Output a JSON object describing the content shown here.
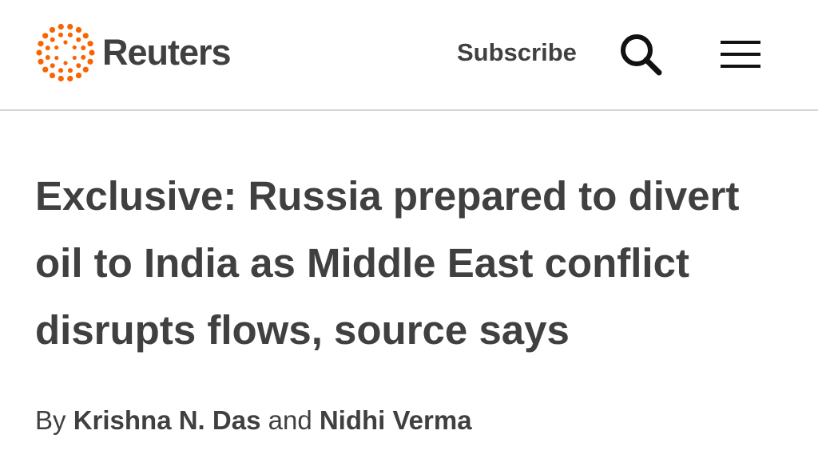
{
  "brand": {
    "name": "Reuters",
    "accent_color": "#fa6400",
    "text_color": "#404040"
  },
  "header": {
    "subscribe_label": "Subscribe",
    "search_icon": "search-icon",
    "menu_icon": "hamburger-menu-icon"
  },
  "article": {
    "headline": "Exclusive: Russia prepared to divert oil to India as Middle East conflict disrupts flows, source says",
    "byline": {
      "prefix": "By",
      "author_1": "Krishna N. Das",
      "conjunction": "and",
      "author_2": "Nidhi Verma"
    }
  }
}
